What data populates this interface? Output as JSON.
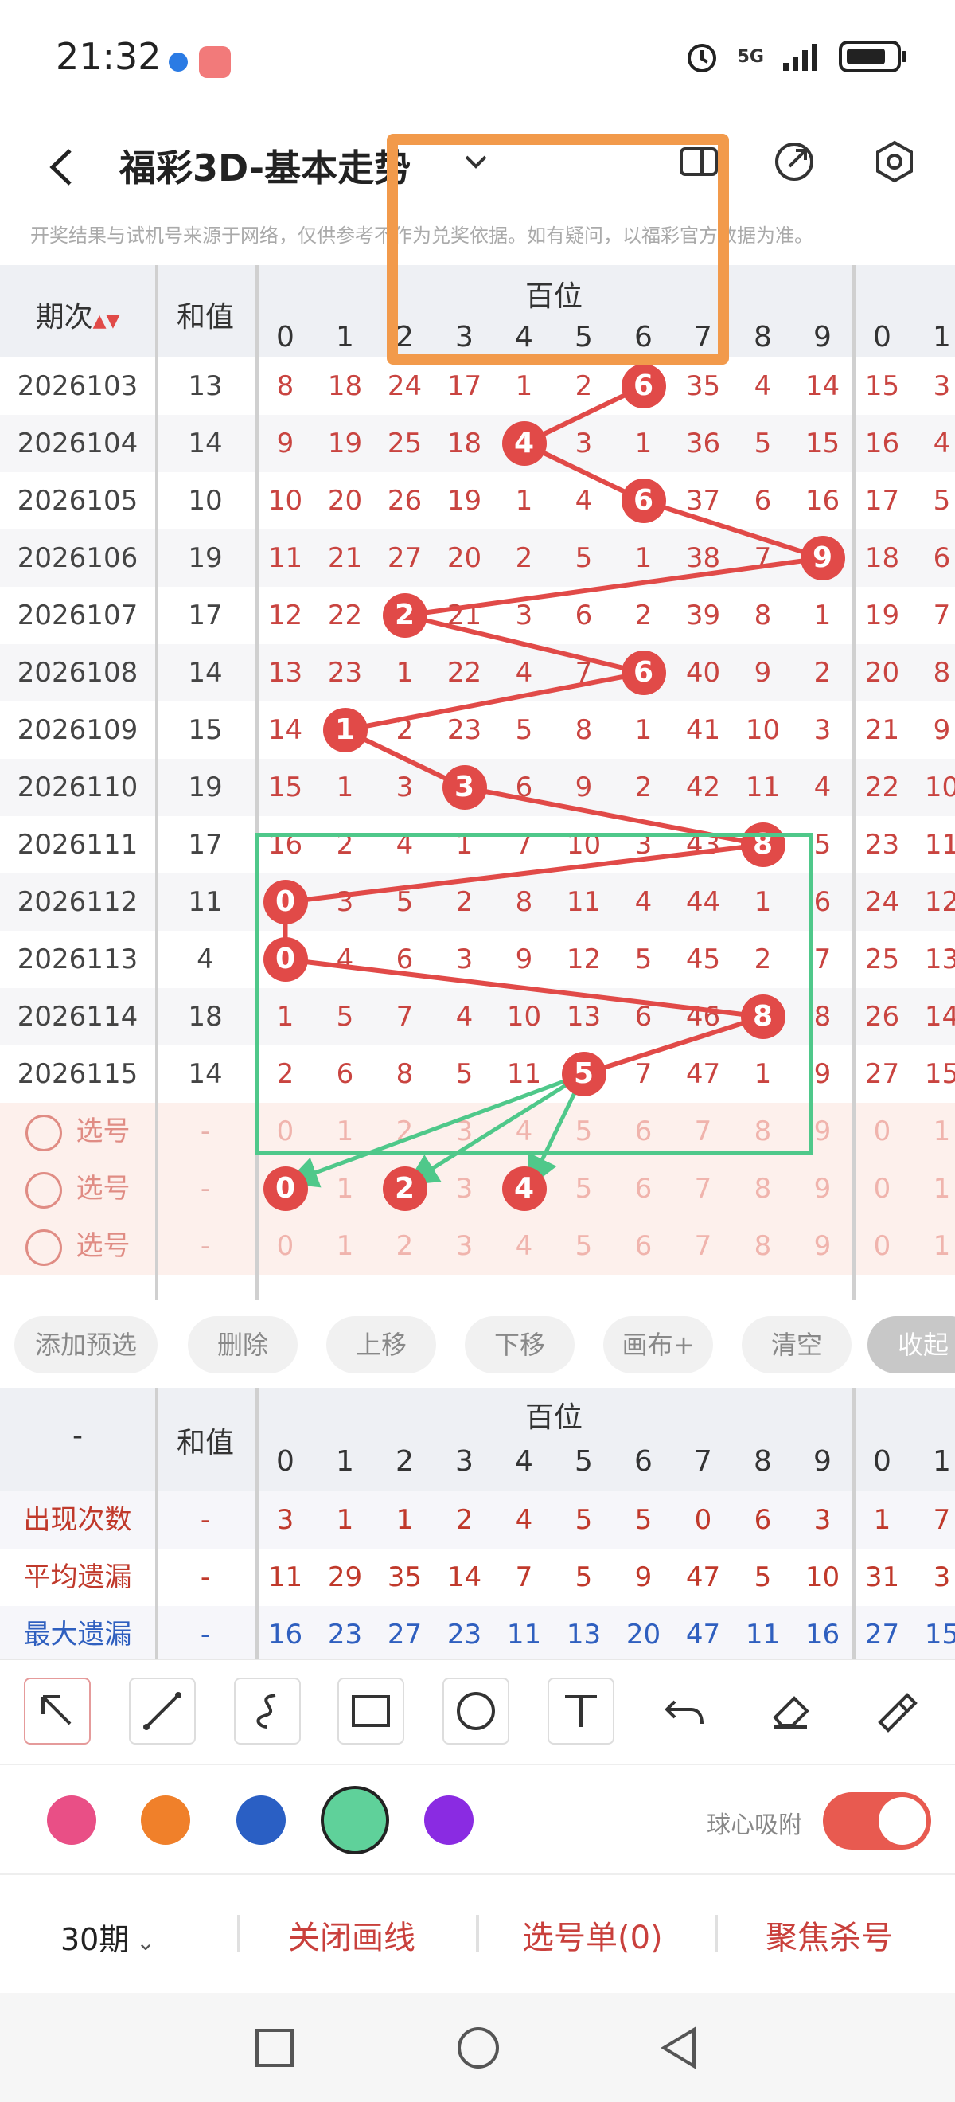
{
  "status": {
    "time": "21:32",
    "network": "5G"
  },
  "header": {
    "title": "福彩3D-基本走势"
  },
  "notice": "开奖结果与试机号来源于网络，仅供参考不作为兑奖依据。如有疑问，以福彩官方数据为准。",
  "table": {
    "col_period": "期次",
    "col_sum": "和值",
    "group_label": "百位",
    "digits": [
      "0",
      "1",
      "2",
      "3",
      "4",
      "5",
      "6",
      "7",
      "8",
      "9"
    ],
    "next_digits": [
      "0",
      "1"
    ],
    "rows": [
      {
        "period": "2026103",
        "sum": "13",
        "cells": [
          "8",
          "18",
          "24",
          "17",
          "1",
          "2",
          "6",
          "35",
          "4",
          "14"
        ],
        "hit": 6,
        "extra": [
          "15",
          "3"
        ]
      },
      {
        "period": "2026104",
        "sum": "14",
        "cells": [
          "9",
          "19",
          "25",
          "18",
          "4",
          "3",
          "1",
          "36",
          "5",
          "15"
        ],
        "hit": 4,
        "extra": [
          "16",
          "4"
        ]
      },
      {
        "period": "2026105",
        "sum": "10",
        "cells": [
          "10",
          "20",
          "26",
          "19",
          "1",
          "4",
          "6",
          "37",
          "6",
          "16"
        ],
        "hit": 6,
        "extra": [
          "17",
          "5"
        ]
      },
      {
        "period": "2026106",
        "sum": "19",
        "cells": [
          "11",
          "21",
          "27",
          "20",
          "2",
          "5",
          "1",
          "38",
          "7",
          "9"
        ],
        "hit": 9,
        "extra": [
          "18",
          "6"
        ]
      },
      {
        "period": "2026107",
        "sum": "17",
        "cells": [
          "12",
          "22",
          "2",
          "21",
          "3",
          "6",
          "2",
          "39",
          "8",
          "1"
        ],
        "hit": 2,
        "extra": [
          "19",
          "7"
        ]
      },
      {
        "period": "2026108",
        "sum": "14",
        "cells": [
          "13",
          "23",
          "1",
          "22",
          "4",
          "7",
          "6",
          "40",
          "9",
          "2"
        ],
        "hit": 6,
        "extra": [
          "20",
          "8"
        ]
      },
      {
        "period": "2026109",
        "sum": "15",
        "cells": [
          "14",
          "1",
          "2",
          "23",
          "5",
          "8",
          "1",
          "41",
          "10",
          "3"
        ],
        "hit": 1,
        "extra": [
          "21",
          "9"
        ]
      },
      {
        "period": "2026110",
        "sum": "19",
        "cells": [
          "15",
          "1",
          "3",
          "3",
          "6",
          "9",
          "2",
          "42",
          "11",
          "4"
        ],
        "hit": 3,
        "extra": [
          "22",
          "10"
        ]
      },
      {
        "period": "2026111",
        "sum": "17",
        "cells": [
          "16",
          "2",
          "4",
          "1",
          "7",
          "10",
          "3",
          "43",
          "8",
          "5"
        ],
        "hit": 8,
        "extra": [
          "23",
          "11"
        ]
      },
      {
        "period": "2026112",
        "sum": "11",
        "cells": [
          "0",
          "3",
          "5",
          "2",
          "8",
          "11",
          "4",
          "44",
          "1",
          "6"
        ],
        "hit": 0,
        "extra": [
          "24",
          "12"
        ]
      },
      {
        "period": "2026113",
        "sum": "4",
        "cells": [
          "0",
          "4",
          "6",
          "3",
          "9",
          "12",
          "5",
          "45",
          "2",
          "7"
        ],
        "hit": 0,
        "extra": [
          "25",
          "13"
        ]
      },
      {
        "period": "2026114",
        "sum": "18",
        "cells": [
          "1",
          "5",
          "7",
          "4",
          "10",
          "13",
          "6",
          "46",
          "8",
          "8"
        ],
        "hit": 8,
        "extra": [
          "26",
          "14"
        ]
      },
      {
        "period": "2026115",
        "sum": "14",
        "cells": [
          "2",
          "6",
          "8",
          "5",
          "11",
          "5",
          "7",
          "47",
          "1",
          "9"
        ],
        "hit": 5,
        "extra": [
          "27",
          "15"
        ]
      }
    ],
    "select_rows": [
      {
        "label": "选号",
        "sum": "-",
        "cells": [
          "0",
          "1",
          "2",
          "3",
          "4",
          "5",
          "6",
          "7",
          "8",
          "9"
        ],
        "picked": [],
        "extra": [
          "0",
          "1"
        ]
      },
      {
        "label": "选号",
        "sum": "-",
        "cells": [
          "0",
          "1",
          "2",
          "3",
          "4",
          "5",
          "6",
          "7",
          "8",
          "9"
        ],
        "picked": [
          0,
          2,
          4
        ],
        "extra": [
          "0",
          "1"
        ]
      },
      {
        "label": "选号",
        "sum": "-",
        "cells": [
          "0",
          "1",
          "2",
          "3",
          "4",
          "5",
          "6",
          "7",
          "8",
          "9"
        ],
        "picked": [],
        "extra": [
          "0",
          "1"
        ]
      }
    ]
  },
  "actions": [
    "添加预选",
    "删除",
    "上移",
    "下移",
    "画布+",
    "清空",
    "收起"
  ],
  "stats": {
    "corner": "-",
    "col_sum": "和值",
    "group_label": "百位",
    "rows": [
      {
        "label": "出现次数",
        "sum": "-",
        "cells": [
          "3",
          "1",
          "1",
          "2",
          "4",
          "5",
          "5",
          "0",
          "6",
          "3"
        ],
        "extra": [
          "1",
          "7"
        ],
        "color": "#c0392b"
      },
      {
        "label": "平均遗漏",
        "sum": "-",
        "cells": [
          "11",
          "29",
          "35",
          "14",
          "7",
          "5",
          "9",
          "47",
          "5",
          "10"
        ],
        "extra": [
          "31",
          "3"
        ],
        "color": "#c0392b"
      },
      {
        "label": "最大遗漏",
        "sum": "-",
        "cells": [
          "16",
          "23",
          "27",
          "23",
          "11",
          "13",
          "20",
          "47",
          "11",
          "16"
        ],
        "extra": [
          "27",
          "15"
        ],
        "color": "#2f5fbf"
      }
    ]
  },
  "palette": {
    "colors": [
      "#e94f86",
      "#f0802a",
      "#2a5fc4",
      "#5fd19a",
      "#8a2be2"
    ],
    "selected": 3,
    "snap_label": "球心吸附",
    "snap_on": true
  },
  "bottom": {
    "period": "30期",
    "close_draw": "关闭画线",
    "pick_list": "选号单(0)",
    "focus_kill": "聚焦杀号"
  }
}
